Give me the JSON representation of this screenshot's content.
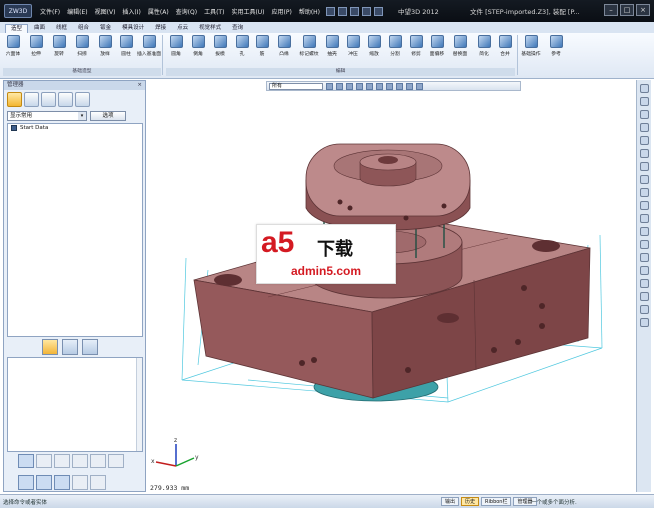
{
  "app": {
    "name": "中望3D 2012",
    "document": "文件 [STEP-imported.Z3], 装配 [P...",
    "logo": "ZW3D"
  },
  "menubar": [
    "文件(F)",
    "编辑(E)",
    "视图(V)",
    "插入(I)",
    "属性(A)",
    "查询(Q)",
    "工具(T)",
    "实用工具(U)",
    "应用(P)",
    "帮助(H)"
  ],
  "ribbon": {
    "tabs": [
      "造型",
      "曲面",
      "线框",
      "组合",
      "钣金",
      "模具设计",
      "焊接",
      "点云",
      "视觉样式",
      "查询"
    ],
    "active_tab": "造型",
    "buttons": [
      {
        "label": "六面体",
        "icon": "box-icon"
      },
      {
        "label": "拉伸",
        "icon": "extrude-icon"
      },
      {
        "label": "旋转",
        "icon": "revolve-icon"
      },
      {
        "label": "扫掠",
        "icon": "sweep-icon"
      },
      {
        "label": "放样",
        "icon": "loft-icon"
      },
      {
        "label": "圆柱",
        "icon": "cylinder-icon"
      },
      {
        "label": "插入基准面",
        "icon": "datum-plane-icon"
      },
      {
        "label": "圆角",
        "icon": "fillet-icon"
      },
      {
        "label": "倒角",
        "icon": "chamfer-icon"
      },
      {
        "label": "拔模",
        "icon": "draft-icon"
      },
      {
        "label": "孔",
        "icon": "hole-icon"
      },
      {
        "label": "筋",
        "icon": "rib-icon"
      },
      {
        "label": "凸缘",
        "icon": "flange-icon"
      },
      {
        "label": "标记螺纹",
        "icon": "thread-icon"
      },
      {
        "label": "抽壳",
        "icon": "shell-icon"
      },
      {
        "label": "冲压",
        "icon": "stamp-icon"
      },
      {
        "label": "缩放",
        "icon": "scale-icon"
      },
      {
        "label": "分割",
        "icon": "split-icon"
      },
      {
        "label": "修剪",
        "icon": "trim-icon"
      },
      {
        "label": "面偏移",
        "icon": "face-offset-icon"
      },
      {
        "label": "替换面",
        "icon": "replace-face-icon"
      },
      {
        "label": "简化",
        "icon": "simplify-icon"
      },
      {
        "label": "合并",
        "icon": "merge-icon"
      },
      {
        "label": "基础操作",
        "icon": "basic-ops-icon"
      },
      {
        "label": "参考",
        "icon": "reference-icon"
      }
    ],
    "groups": [
      "基础造型",
      "编辑"
    ]
  },
  "left_panel": {
    "title": "管理器",
    "dropdown_value": "显示常用",
    "options_button": "选项",
    "tree_items": [
      "Start Data"
    ]
  },
  "viewport": {
    "filter_value": "所有",
    "coordinate": "279.933 mm",
    "watermark": {
      "big": "a5",
      "cn": "下载",
      "url": "admin5.com"
    }
  },
  "statusbar": {
    "hint": "选择命令或者实体",
    "tabs": [
      "输出",
      "历史",
      "Ribbon栏",
      "管理器"
    ],
    "active_tab": "历史",
    "message": "一个或多个面分析."
  },
  "colors": {
    "part_body": "#9c6263",
    "part_shadow": "#6f3a3c",
    "base": "#4aa9b0",
    "wire": "#48c7dd"
  }
}
